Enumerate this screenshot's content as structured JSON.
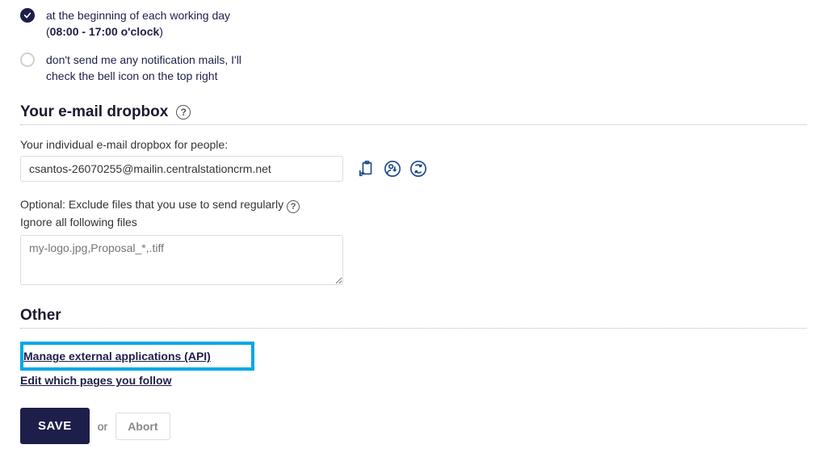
{
  "notifications": {
    "option1": {
      "pre": "at the beginning of each working day (",
      "bold": "08:00 - 17:00 o'clock",
      "post": ")"
    },
    "option2": "don't send me any notification mails, I'll check the bell icon on the top right"
  },
  "dropbox": {
    "section_title": "Your e-mail dropbox",
    "field_label": "Your individual e-mail dropbox for people:",
    "email_value": "csantos-26070255@mailin.centralstationcrm.net",
    "exclude_label": "Optional: Exclude files that you use to send regularly",
    "ignore_label": "Ignore all following files",
    "textarea_placeholder": "my-logo.jpg,Proposal_*,.tiff"
  },
  "other": {
    "section_title": "Other",
    "link_api": "Manage external applications (API)",
    "link_follow": "Edit which pages you follow"
  },
  "footer": {
    "save_label": "SAVE",
    "or_label": "or",
    "abort_label": "Abort"
  }
}
